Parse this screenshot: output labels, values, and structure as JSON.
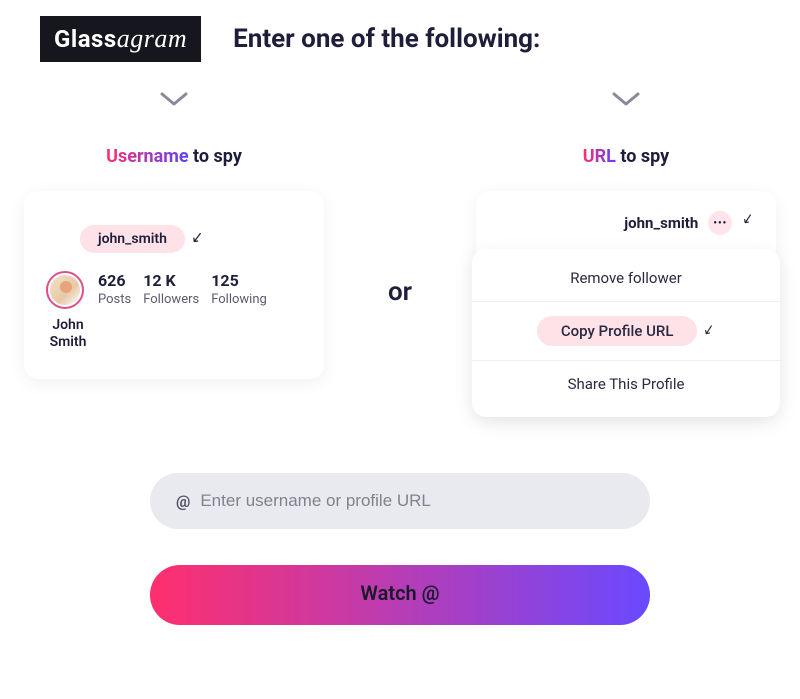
{
  "brand": {
    "glass": "Glass",
    "agram": "agram"
  },
  "title": "Enter one of the following:",
  "left": {
    "title_highlight": "Username",
    "title_rest": " to spy",
    "username": "john_smith",
    "display_name_line1": "John",
    "display_name_line2": "Smith",
    "stats": {
      "posts_num": "626",
      "posts_lbl": "Posts",
      "followers_num": "12 K",
      "followers_lbl": "Followers",
      "following_num": "125",
      "following_lbl": "Following"
    }
  },
  "right": {
    "title_highlight": "URL",
    "title_rest": " to spy",
    "username": "john_smith",
    "menu": {
      "remove": "Remove follower",
      "copy": "Copy Profile URL",
      "share": "Share This Profile"
    }
  },
  "middle_or": "or",
  "input": {
    "placeholder": "Enter username or profile URL",
    "at": "@"
  },
  "button": "Watch @",
  "arrows": {
    "left": "↙",
    "right_top": "↙",
    "right_copy": "↙"
  }
}
